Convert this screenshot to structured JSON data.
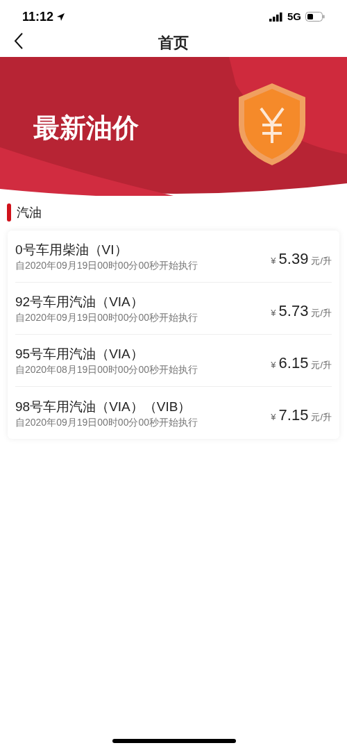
{
  "status_bar": {
    "time": "11:12",
    "network": "5G"
  },
  "nav": {
    "title": "首页"
  },
  "banner": {
    "title": "最新油价"
  },
  "section": {
    "title": "汽油"
  },
  "prices": [
    {
      "name": "0号车用柴油（VI）",
      "effective": "自2020年09月19日00时00分00秒开始执行",
      "currency": "¥",
      "price": "5.39",
      "unit": "元/升"
    },
    {
      "name": "92号车用汽油（VIA）",
      "effective": "自2020年09月19日00时00分00秒开始执行",
      "currency": "¥",
      "price": "5.73",
      "unit": "元/升"
    },
    {
      "name": "95号车用汽油（VIA）",
      "effective": "自2020年08月19日00时00分00秒开始执行",
      "currency": "¥",
      "price": "6.15",
      "unit": "元/升"
    },
    {
      "name": "98号车用汽油（VIA）（VIB）",
      "effective": "自2020年09月19日00时00分00秒开始执行",
      "currency": "¥",
      "price": "7.15",
      "unit": "元/升"
    }
  ]
}
